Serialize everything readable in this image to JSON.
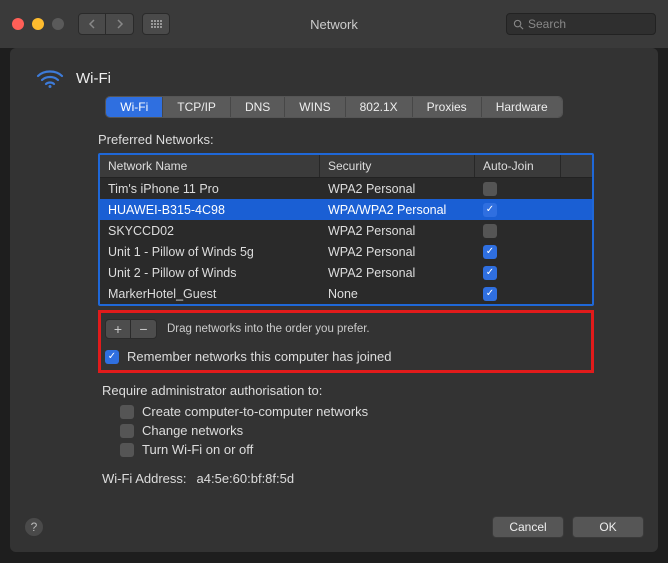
{
  "window": {
    "title": "Network",
    "search_placeholder": "Search"
  },
  "header": {
    "title": "Wi-Fi"
  },
  "tabs": [
    "Wi-Fi",
    "TCP/IP",
    "DNS",
    "WINS",
    "802.1X",
    "Proxies",
    "Hardware"
  ],
  "active_tab": 0,
  "section": {
    "preferred_label": "Preferred Networks:"
  },
  "table": {
    "columns": {
      "name": "Network Name",
      "security": "Security",
      "auto": "Auto-Join"
    },
    "rows": [
      {
        "name": "Tim's iPhone 11 Pro",
        "security": "WPA2 Personal",
        "auto": false,
        "selected": false
      },
      {
        "name": "HUAWEI-B315-4C98",
        "security": "WPA/WPA2 Personal",
        "auto": true,
        "selected": true
      },
      {
        "name": "SKYCCD02",
        "security": "WPA2 Personal",
        "auto": false,
        "selected": false
      },
      {
        "name": "Unit 1 - Pillow of Winds 5g",
        "security": "WPA2 Personal",
        "auto": true,
        "selected": false
      },
      {
        "name": "Unit 2 - Pillow of Winds",
        "security": "WPA2 Personal",
        "auto": true,
        "selected": false
      },
      {
        "name": "MarkerHotel_Guest",
        "security": "None",
        "auto": true,
        "selected": false
      }
    ]
  },
  "controls": {
    "add": "+",
    "remove": "−",
    "drag_hint": "Drag networks into the order you prefer.",
    "remember_label": "Remember networks this computer has joined",
    "remember_checked": true
  },
  "auth": {
    "label": "Require administrator authorisation to:",
    "items": [
      {
        "label": "Create computer-to-computer networks",
        "checked": false
      },
      {
        "label": "Change networks",
        "checked": false
      },
      {
        "label": "Turn Wi-Fi on or off",
        "checked": false
      }
    ]
  },
  "address": {
    "label": "Wi-Fi Address:",
    "value": "a4:5e:60:bf:8f:5d"
  },
  "footer": {
    "help": "?",
    "cancel": "Cancel",
    "ok": "OK"
  }
}
